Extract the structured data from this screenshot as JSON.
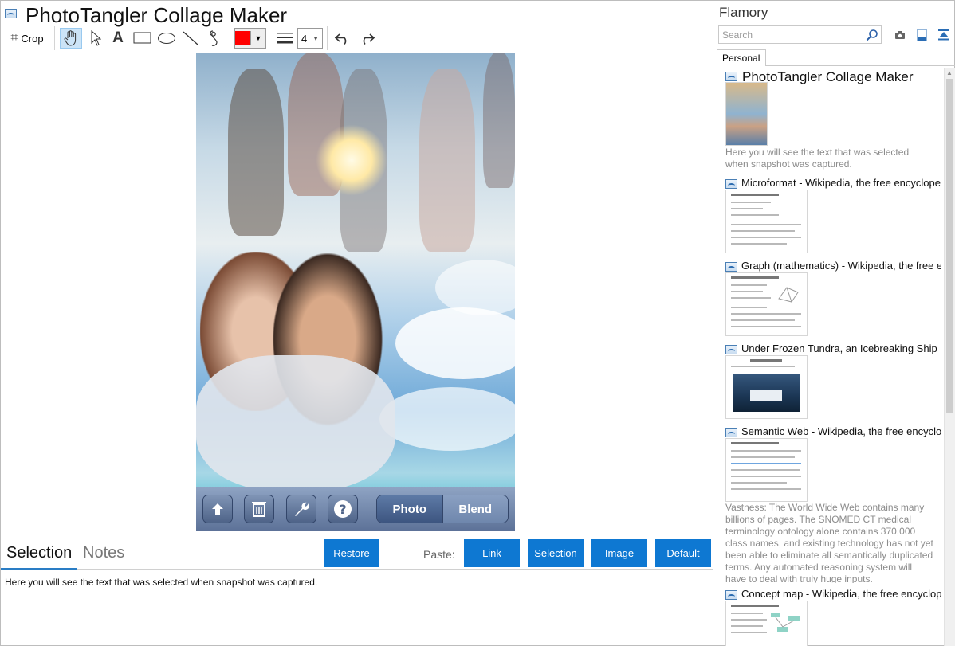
{
  "window": {
    "title": "PhotoTangler Collage Maker"
  },
  "toolbar": {
    "crop_label": "Crop",
    "tools": [
      "hand-tool",
      "select-tool",
      "text-tool",
      "rectangle-tool",
      "ellipse-tool",
      "line-tool",
      "lasso-tool"
    ],
    "stroke_color": "#ff0000",
    "line_width": "4"
  },
  "image_app": {
    "segment_on": "Photo",
    "segment_off": "Blend",
    "buttons": [
      "upload-icon",
      "trash-icon",
      "wrench-icon",
      "help-icon"
    ]
  },
  "bottom": {
    "tab_selection": "Selection",
    "tab_notes": "Notes",
    "restore": "Restore",
    "paste_label": "Paste:",
    "paste_link": "Link",
    "paste_selection": "Selection",
    "paste_image": "Image",
    "paste_default": "Default",
    "selection_text": "Here you will see the text that was selected when snapshot was captured."
  },
  "side": {
    "title": "Flamory",
    "search_placeholder": "Search",
    "tab": "Personal",
    "items": [
      {
        "title": "PhotoTangler Collage Maker",
        "desc": "Here you will see the text that was selected when snapshot was captured."
      },
      {
        "title": "Microformat - Wikipedia, the free encyclopedia"
      },
      {
        "title": "Graph (mathematics) - Wikipedia, the free ency"
      },
      {
        "title": "Under Frozen Tundra, an Icebreaking Ship Unco"
      },
      {
        "title": "Semantic Web - Wikipedia, the free encycloped",
        "desc": "Vastness: The World Wide Web contains many billions of pages. The SNOMED CT medical terminology ontology alone contains 370,000 class names, and existing technology has not yet been able to eliminate all semantically duplicated terms. Any automated reasoning system will have to deal with truly huge inputs."
      },
      {
        "title": "Concept map - Wikipedia, the free encyclopedia"
      }
    ]
  }
}
